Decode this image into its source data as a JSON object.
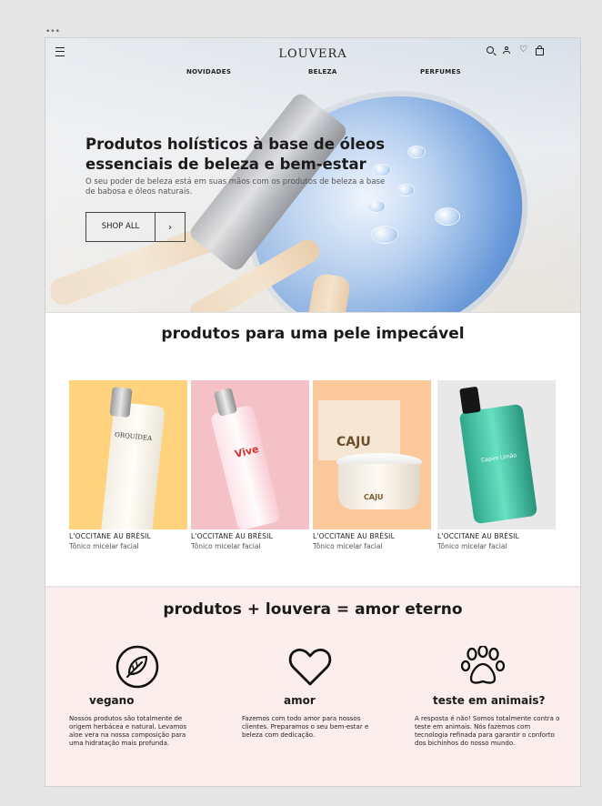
{
  "header": {
    "logo": "LOUVERA",
    "nav": [
      "NOVIDADES",
      "BELEZA",
      "PERFUMES"
    ]
  },
  "hero": {
    "title": "Produtos holísticos à base de óleos essenciais de beleza e bem-estar",
    "subtitle": "O seu poder de beleza está em suas mãos com os produtos de beleza a base de babosa e óleos naturais.",
    "cta": "SHOP ALL"
  },
  "products_section": {
    "title": "produtos para uma pele impecável",
    "items": [
      {
        "brand": "L'OCCITANE AU BRÉSIL",
        "name": "Tônico micelar facial"
      },
      {
        "brand": "L'OCCITANE AU BRÉSIL",
        "name": "Tônico micelar facial"
      },
      {
        "brand": "L'OCCITANE AU BRÉSIL",
        "name": "Tônico micelar facial"
      },
      {
        "brand": "L'OCCITANE AU BRÉSIL",
        "name": "Tônico micelar facial"
      }
    ],
    "image_labels": [
      "ORQUÍDEA",
      "Vive",
      "CAJU",
      "CAJU",
      "Capim Limão"
    ]
  },
  "love_section": {
    "title": "produtos + louvera = amor eterno",
    "features": [
      {
        "title": "vegano",
        "text": "Nossos produtos são totalmente de origem herbácea e natural. Levamos aloe vera na nossa composição para uma hidratação mais profunda."
      },
      {
        "title": "amor",
        "text": "Fazemos com todo amor para nossos clientes. Preparamos o seu bem-estar e beleza com dedicação."
      },
      {
        "title": "teste em animais?",
        "text": "A resposta é não! Somos totalmente contra o teste em animais. Nós fazemos com tecnologia refinada para garantir o conforto dos bichinhos do nosso mundo."
      }
    ]
  },
  "icons": {
    "menu": "menu-icon",
    "search": "search-icon",
    "user": "user-icon",
    "wishlist": "heart-icon",
    "cart": "bag-icon",
    "cta_arrow": "chevron-right-icon",
    "vegan": "leaf-icon",
    "love": "heart-icon",
    "animals": "paw-icon"
  }
}
